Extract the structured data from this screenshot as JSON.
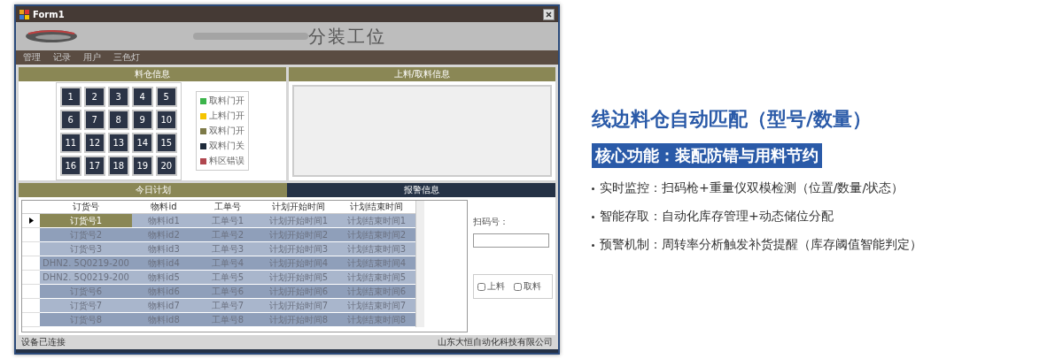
{
  "window": {
    "title": "Form1",
    "app_title": "分装工位",
    "menu": [
      "管理",
      "记录",
      "用户",
      "三色灯"
    ]
  },
  "bin_panel": {
    "title": "料仓信息",
    "bins": [
      "1",
      "2",
      "3",
      "4",
      "5",
      "6",
      "7",
      "8",
      "9",
      "10",
      "11",
      "12",
      "13",
      "14",
      "15",
      "16",
      "17",
      "18",
      "19",
      "20"
    ],
    "legend": [
      {
        "label": "取料门开",
        "color": "#3cb44b"
      },
      {
        "label": "上料门开",
        "color": "#f5c400"
      },
      {
        "label": "双料门开",
        "color": "#7d7a48"
      },
      {
        "label": "双料门关",
        "color": "#1e2a3a"
      },
      {
        "label": "料区错误",
        "color": "#b0474f"
      }
    ]
  },
  "load_panel": {
    "title": "上料/取料信息"
  },
  "tabs": [
    {
      "label": "今日计划",
      "selected": true
    },
    {
      "label": "报警信息",
      "selected": false
    }
  ],
  "table": {
    "columns": [
      "订货号",
      "物料id",
      "工单号",
      "计划开始时间",
      "计划结束时间"
    ],
    "rows": [
      {
        "selected": true,
        "cells": [
          "订货号1",
          "物料id1",
          "工单号1",
          "计划开始时间1",
          "计划结束时间1"
        ]
      },
      {
        "selected": false,
        "cells": [
          "订货号2",
          "物料id2",
          "工单号2",
          "计划开始时间2",
          "计划结束时间2"
        ]
      },
      {
        "selected": false,
        "cells": [
          "订货号3",
          "物料id3",
          "工单号3",
          "计划开始时间3",
          "计划结束时间3"
        ]
      },
      {
        "selected": false,
        "cells": [
          "DHN2. 5Q0219-200",
          "物料id4",
          "工单号4",
          "计划开始时间4",
          "计划结束时间4"
        ]
      },
      {
        "selected": false,
        "cells": [
          "DHN2. 5Q0219-200",
          "物料id5",
          "工单号5",
          "计划开始时间5",
          "计划结束时间5"
        ]
      },
      {
        "selected": false,
        "cells": [
          "订货号6",
          "物料id6",
          "工单号6",
          "计划开始时间6",
          "计划结束时间6"
        ]
      },
      {
        "selected": false,
        "cells": [
          "订货号7",
          "物料id7",
          "工单号7",
          "计划开始时间7",
          "计划结束时间7"
        ]
      },
      {
        "selected": false,
        "cells": [
          "订货号8",
          "物料id8",
          "工单号8",
          "计划开始时间8",
          "计划结束时间8"
        ]
      }
    ]
  },
  "scan": {
    "label": "扫码号：",
    "checkboxes": [
      {
        "label": "上料",
        "checked": false
      },
      {
        "label": "取料",
        "checked": false
      }
    ]
  },
  "status_bar": {
    "left": "设备已连接",
    "right": "山东大恒自动化科技有限公司"
  },
  "promo": {
    "title": "线边料仓自动匹配（型号/数量）",
    "banner": "核心功能：装配防错与用料节约",
    "bullets": [
      {
        "head": "实时监控：",
        "text": "扫码枪+重量仪双模检测（位置/数量/状态）"
      },
      {
        "head": "智能存取：",
        "text": "自动化库存管理+动态储位分配"
      },
      {
        "head": "预警机制：",
        "text": "周转率分析触发补货提醒（库存阈值智能判定）"
      }
    ]
  }
}
